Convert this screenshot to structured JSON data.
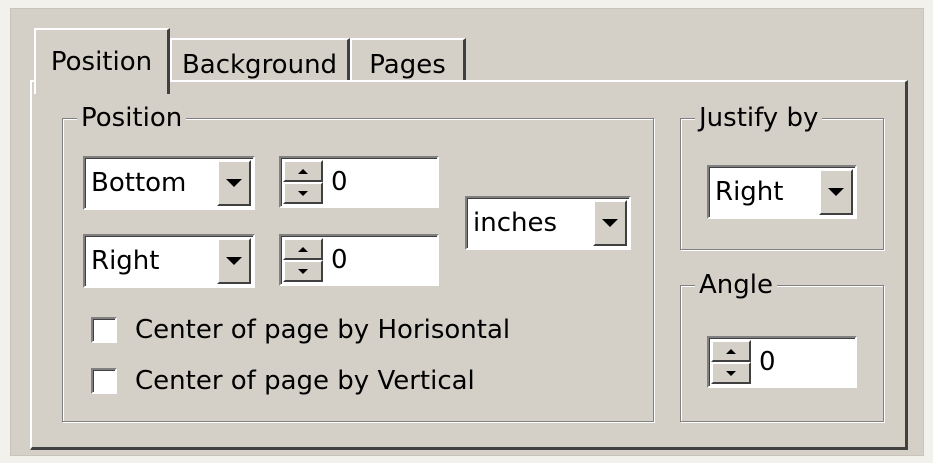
{
  "tabs": [
    {
      "label": "Position",
      "active": true
    },
    {
      "label": "Background",
      "active": false
    },
    {
      "label": "Pages",
      "active": false
    }
  ],
  "position_group": {
    "title": "Position",
    "vertical_select": {
      "value": "Bottom"
    },
    "vertical_offset": {
      "value": "0"
    },
    "horizontal_select": {
      "value": "Right"
    },
    "horizontal_offset": {
      "value": "0"
    },
    "units_select": {
      "value": "inches"
    },
    "center_horizontal": {
      "label": "Center of page by Horisontal",
      "checked": false
    },
    "center_vertical": {
      "label": "Center of page by Vertical",
      "checked": false
    }
  },
  "justify_group": {
    "title": "Justify by",
    "select": {
      "value": "Right"
    }
  },
  "angle_group": {
    "title": "Angle",
    "spin": {
      "value": "0"
    }
  },
  "icons": [
    "dropdown-arrow-icon",
    "spin-up-icon",
    "spin-down-icon"
  ],
  "colors": {
    "face": "#d4d0c8",
    "highlight": "#ffffff",
    "shadow": "#808080",
    "dark_shadow": "#404040",
    "field": "#ffffff"
  }
}
